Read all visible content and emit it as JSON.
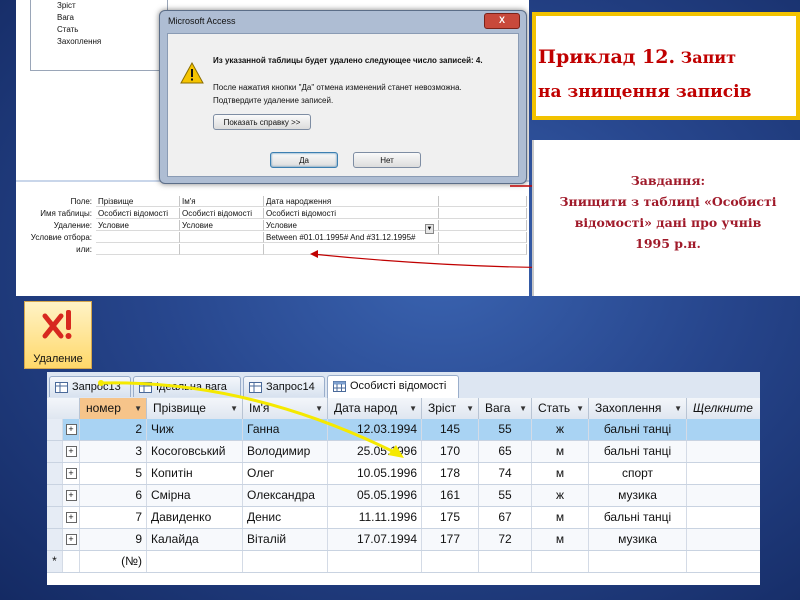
{
  "field_list": [
    "Зріст",
    "Вага",
    "Стать",
    "Захоплення"
  ],
  "dialog": {
    "title": "Microsoft Access",
    "close": "X",
    "message_main": "Из указанной таблицы будет удалено следующее число записей: 4.",
    "message_line2": "После нажатия кнопки \"Да\" отмена изменений станет невозможна.",
    "message_line3": "Подтвердите удаление записей.",
    "help_button": "Показать справку >>",
    "yes_button": "Да",
    "no_button": "Нет"
  },
  "query_grid": {
    "labels": [
      "Поле:",
      "Имя таблицы:",
      "Удаление:",
      "Условие отбора:",
      "или:"
    ],
    "columns": [
      {
        "field": "Прізвище",
        "table": "Особисті відомості",
        "delete": "Условие",
        "criteria": ""
      },
      {
        "field": "Ім'я",
        "table": "Особисті відомості",
        "delete": "Условие",
        "criteria": ""
      },
      {
        "field": "Дата народження",
        "table": "Особисті відомості",
        "delete": "Условие",
        "criteria": "Between #01.01.1995# And #31.12.1995#"
      }
    ]
  },
  "title_card": {
    "line1_big": "Приклад 12.",
    "line1_small": " Запит",
    "line2": "на знищення записів"
  },
  "task_card": {
    "heading": "Завдання:",
    "line1": "Знищити з таблиці «Особисті",
    "line2": "відомості» дані про учнів",
    "line3": "1995 р.н."
  },
  "delete_button": {
    "label": "Удаление"
  },
  "tabs": [
    {
      "label": "Запрос13",
      "active": false
    },
    {
      "label": "Ідеальна вага",
      "active": false
    },
    {
      "label": "Запрос14",
      "active": false
    },
    {
      "label": "Особисті відомості",
      "active": true
    }
  ],
  "table": {
    "headers": [
      "номер",
      "Прізвище",
      "Ім'я",
      "Дата народ",
      "Зріст",
      "Вага",
      "Стать",
      "Захоплення",
      "Щелкните"
    ],
    "rows": [
      {
        "expand": "+",
        "num": "2",
        "surname": "Чиж",
        "name": "Ганна",
        "date": "12.03.1994",
        "height": "145",
        "weight": "55",
        "sex": "ж",
        "hobby": "бальні танці"
      },
      {
        "expand": "+",
        "num": "3",
        "surname": "Косоговський",
        "name": "Володимир",
        "date": "25.05.1996",
        "height": "170",
        "weight": "65",
        "sex": "м",
        "hobby": "бальні танці"
      },
      {
        "expand": "+",
        "num": "5",
        "surname": "Копитін",
        "name": "Олег",
        "date": "10.05.1996",
        "height": "178",
        "weight": "74",
        "sex": "м",
        "hobby": "спорт"
      },
      {
        "expand": "+",
        "num": "6",
        "surname": "Смірна",
        "name": "Олександра",
        "date": "05.05.1996",
        "height": "161",
        "weight": "55",
        "sex": "ж",
        "hobby": "музика"
      },
      {
        "expand": "+",
        "num": "7",
        "surname": "Давиденко",
        "name": "Денис",
        "date": "11.11.1996",
        "height": "175",
        "weight": "67",
        "sex": "м",
        "hobby": "бальні танці"
      },
      {
        "expand": "+",
        "num": "9",
        "surname": "Калайда",
        "name": "Віталій",
        "date": "17.07.1994",
        "height": "177",
        "weight": "72",
        "sex": "м",
        "hobby": "музика"
      }
    ],
    "new_row": {
      "marker": "*",
      "num": "(№)"
    }
  },
  "colors": {
    "accent_red": "#c00000",
    "title_border": "#f2c200",
    "arrow_yellow": "#f5e900",
    "selected_row": "#a9d3f3"
  }
}
